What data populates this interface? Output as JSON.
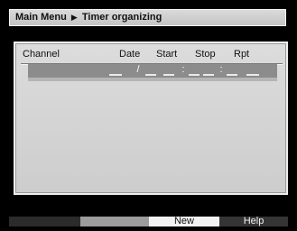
{
  "header": {
    "crumb_root": "Main Menu",
    "crumb_separator": "▶",
    "crumb_current": "Timer organizing"
  },
  "table": {
    "columns": [
      "Channel",
      "Date",
      "Start",
      "Stop",
      "Rpt"
    ],
    "selected_row": {
      "date_separator": "/",
      "time_separator": ":",
      "stop_separator": ":"
    }
  },
  "function_keys": {
    "red": "",
    "green": "",
    "yellow": "New",
    "blue": "Help"
  },
  "colors": {
    "background": "#000000",
    "panel": "#d4d4d4",
    "selected_row": "#8c8c8c",
    "key_red": "#2b2b2b",
    "key_green": "#9c9c9c",
    "key_yellow": "#f2f2f2",
    "key_blue": "#353535"
  }
}
